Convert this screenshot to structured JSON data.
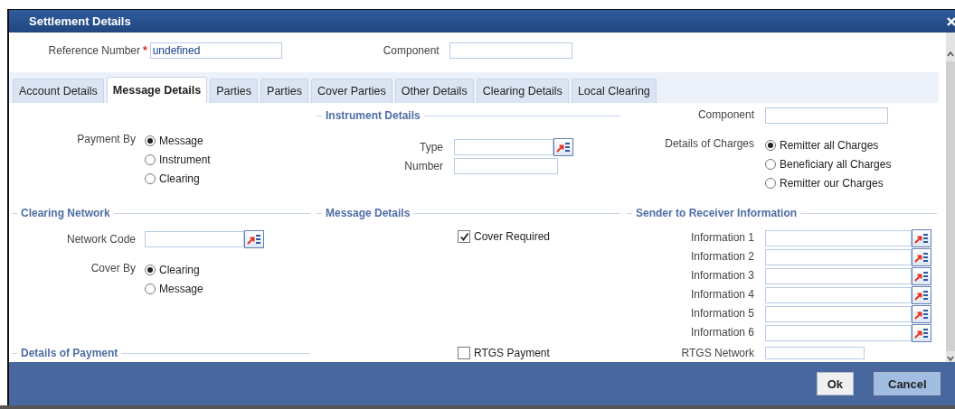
{
  "window": {
    "title": "Settlement Details"
  },
  "reference_number": {
    "label": "Reference Number",
    "required_mark": "*",
    "value": "undefined"
  },
  "header_component": {
    "label": "Component"
  },
  "tabs": [
    {
      "label": "Account Details",
      "selected": false
    },
    {
      "label": "Message Details",
      "selected": true
    },
    {
      "label": "Parties",
      "selected": false
    },
    {
      "label": "Parties",
      "selected": false
    },
    {
      "label": "Cover Parties",
      "selected": false
    },
    {
      "label": "Other Details",
      "selected": false
    },
    {
      "label": "Clearing Details",
      "selected": false
    },
    {
      "label": "Local Clearing",
      "selected": false
    }
  ],
  "payment_by": {
    "label": "Payment By",
    "options": [
      {
        "label": "Message",
        "selected": true
      },
      {
        "label": "Instrument",
        "selected": false
      },
      {
        "label": "Clearing",
        "selected": false
      }
    ]
  },
  "instrument_details": {
    "title": "Instrument Details",
    "fields": [
      {
        "label": "Type",
        "kind": "lookup"
      },
      {
        "label": "Number",
        "kind": "text"
      }
    ]
  },
  "component": {
    "label": "Component"
  },
  "details_of_charges": {
    "label": "Details of Charges",
    "options": [
      {
        "label": "Remitter all Charges",
        "selected": true
      },
      {
        "label": "Beneficiary all Charges",
        "selected": false
      },
      {
        "label": "Remitter our Charges",
        "selected": false
      }
    ]
  },
  "clearing_network": {
    "title": "Clearing Network",
    "network_code": {
      "label": "Network Code"
    },
    "cover_by": {
      "label": "Cover By",
      "options": [
        {
          "label": "Clearing",
          "selected": true
        },
        {
          "label": "Message",
          "selected": false
        }
      ]
    }
  },
  "message_details": {
    "title": "Message Details",
    "cover_required": {
      "label": "Cover Required",
      "checked": true
    }
  },
  "sender_to_receiver": {
    "title": "Sender to Receiver Information",
    "fields": [
      {
        "label": "Information 1"
      },
      {
        "label": "Information 2"
      },
      {
        "label": "Information 3"
      },
      {
        "label": "Information 4"
      },
      {
        "label": "Information 5"
      },
      {
        "label": "Information 6"
      }
    ]
  },
  "details_of_payment": {
    "title": "Details of Payment"
  },
  "rtgs_payment": {
    "label": "RTGS Payment",
    "checked": false
  },
  "rtgs_network": {
    "label": "RTGS Network"
  },
  "buttons": [
    {
      "label": "Ok",
      "kind": "default"
    },
    {
      "label": "Cancel",
      "kind": "primary"
    }
  ]
}
